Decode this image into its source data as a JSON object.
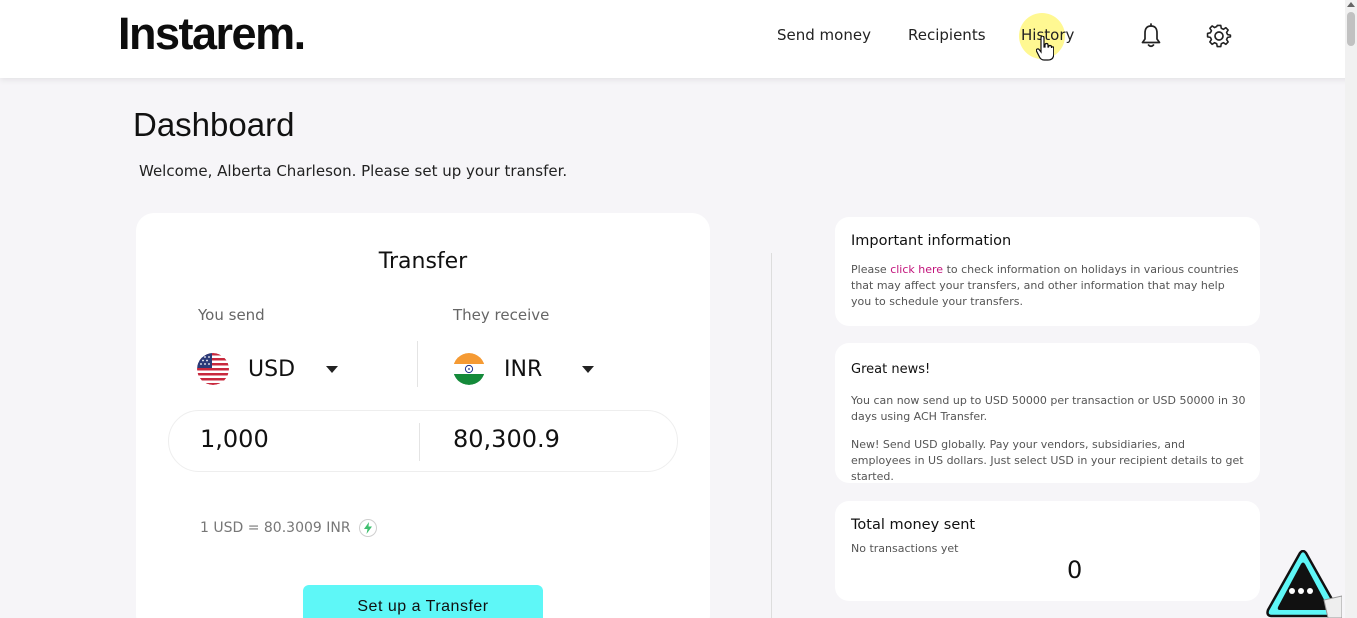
{
  "header": {
    "logo": "Instarem.",
    "nav": {
      "send_money": "Send money",
      "recipients": "Recipients",
      "history": "History"
    },
    "icons": [
      "bell-icon",
      "gear-icon"
    ]
  },
  "page": {
    "title": "Dashboard",
    "welcome": "Welcome, Alberta Charleson. Please set up your transfer."
  },
  "transfer": {
    "title": "Transfer",
    "you_send_label": "You send",
    "they_receive_label": "They receive",
    "send_currency": "USD",
    "receive_currency": "INR",
    "send_amount": "1,000",
    "receive_amount": "80,300.9",
    "rate_text": "1 USD = 80.3009 INR",
    "button_label": "Set up a Transfer"
  },
  "important_info": {
    "title": "Important information",
    "text_before": "Please ",
    "link_text": "click here",
    "text_after": " to check information on holidays in various countries that may affect your transfers, and other information that may help you to schedule your transfers."
  },
  "great_news": {
    "title": "Great news!",
    "para1": "You can now send up to USD 50000 per transaction or USD 50000 in 30 days using ACH Transfer.",
    "para2": "New! Send USD globally. Pay your vendors, subsidiaries, and employees in US dollars. Just select USD in your recipient details to get started."
  },
  "total_sent": {
    "title": "Total money sent",
    "subtitle": "No transactions yet",
    "value": "0"
  },
  "colors": {
    "accent_button": "#5ef7f7",
    "link": "#c2127b",
    "page_bg": "#f6f5f8"
  }
}
